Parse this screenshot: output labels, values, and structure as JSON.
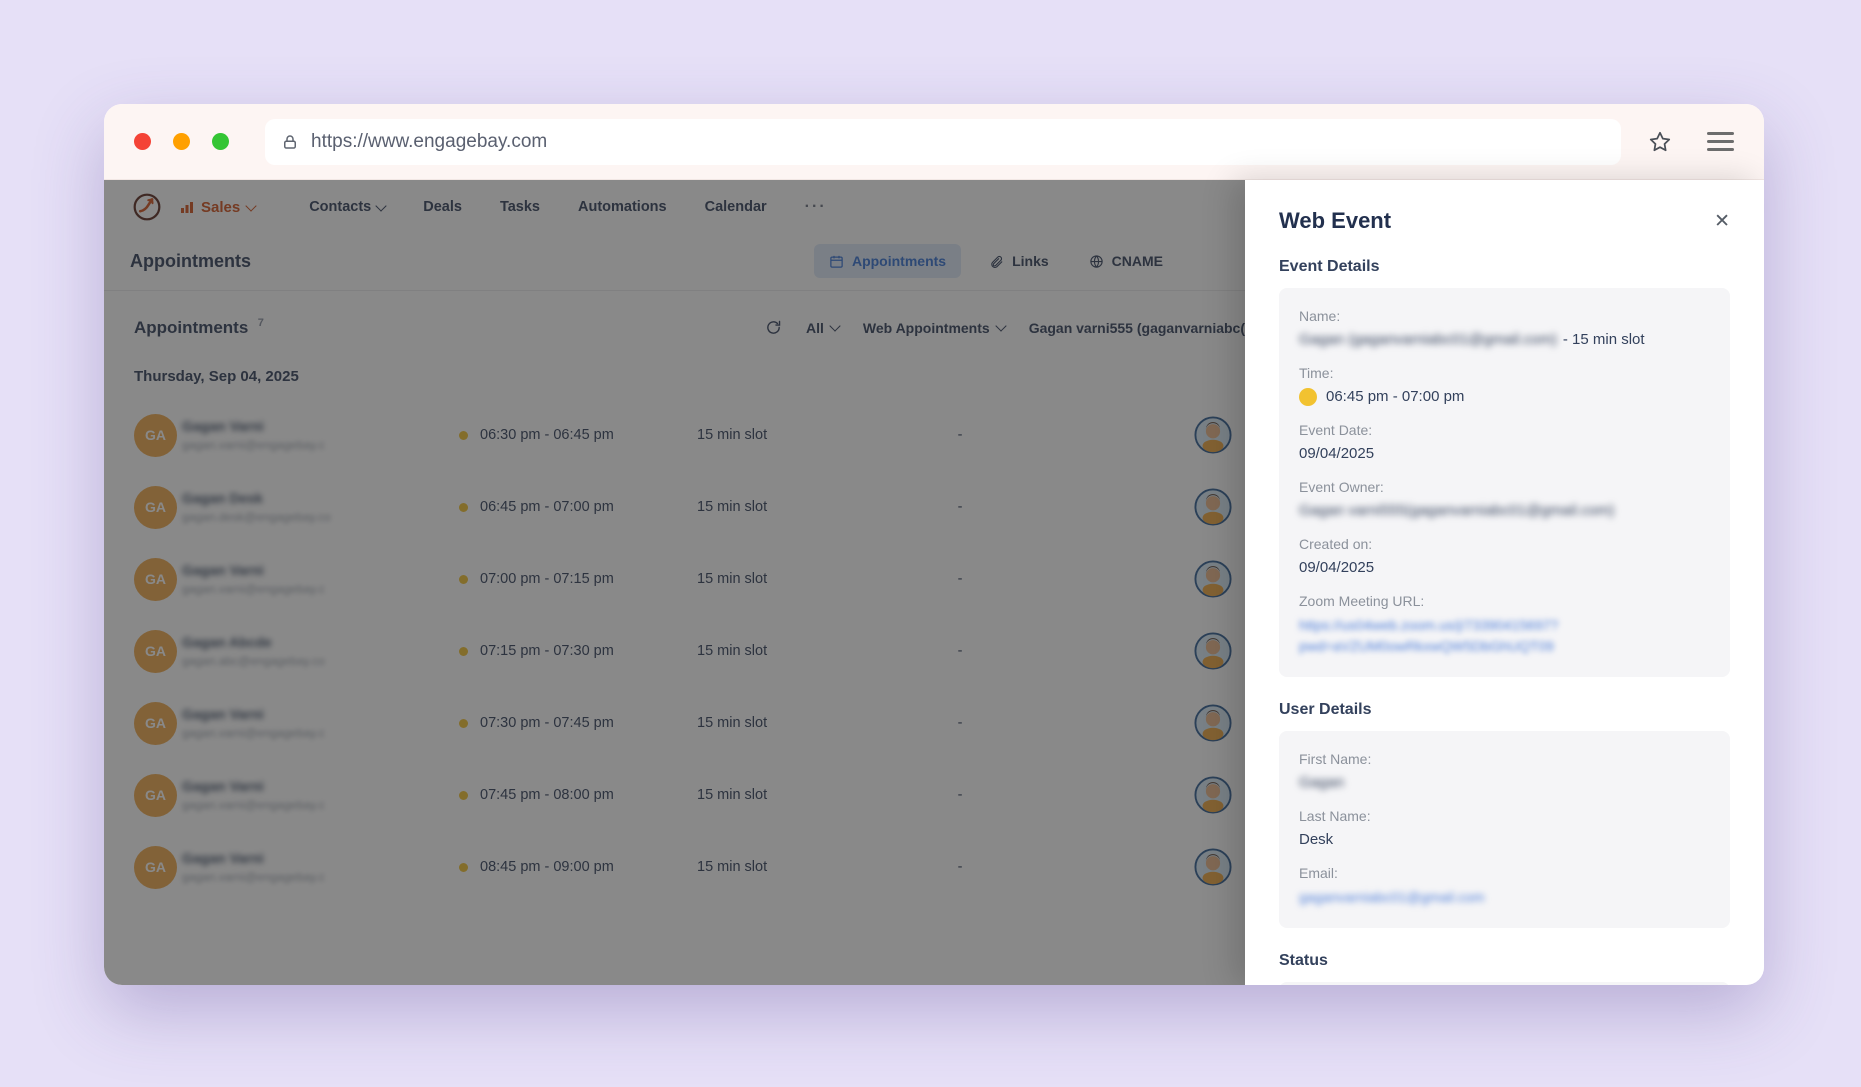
{
  "colors": {
    "brand_orange": "#d2521e",
    "navy_text": "#33415c",
    "active_tab_blue": "#3572d3",
    "slot_yellow": "#f2c230",
    "avatar_orange": "#efa94d",
    "background_lavender": "#e6e0f7"
  },
  "browser": {
    "url": "https://www.engagebay.com"
  },
  "app_nav": {
    "sales_label": "Sales",
    "items": [
      {
        "label": "Contacts"
      },
      {
        "label": "Deals"
      },
      {
        "label": "Tasks"
      },
      {
        "label": "Automations"
      },
      {
        "label": "Calendar"
      }
    ],
    "more_glyph": "···"
  },
  "page_header": {
    "title": "Appointments",
    "tabs": [
      {
        "label": "Appointments"
      },
      {
        "label": "Links"
      },
      {
        "label": "CNAME"
      }
    ]
  },
  "toolbar": {
    "heading": "Appointments",
    "count": "7",
    "filter_all": "All",
    "filter_type": "Web Appointments",
    "filter_owner": "Gagan varni555 (gaganvarniabc("
  },
  "list": {
    "date_header": "Thursday, Sep 04, 2025",
    "rows": [
      {
        "initials": "GA",
        "name_blurred": "Gagan Varni",
        "email_blurred": "gagan.varni@engagebay.c",
        "time": "06:30 pm - 06:45 pm",
        "slot": "15 min slot",
        "empty": "-"
      },
      {
        "initials": "GA",
        "name_blurred": "Gagan Desk",
        "email_blurred": "gagan.desk@engagebay.co",
        "time": "06:45 pm - 07:00 pm",
        "slot": "15 min slot",
        "empty": "-"
      },
      {
        "initials": "GA",
        "name_blurred": "Gagan Varni",
        "email_blurred": "gagan.varni@engagebay.c",
        "time": "07:00 pm - 07:15 pm",
        "slot": "15 min slot",
        "empty": "-"
      },
      {
        "initials": "GA",
        "name_blurred": "Gagan Abcde",
        "email_blurred": "gagan.abc@engagebay.co",
        "time": "07:15 pm - 07:30 pm",
        "slot": "15 min slot",
        "empty": "-"
      },
      {
        "initials": "GA",
        "name_blurred": "Gagan Varni",
        "email_blurred": "gagan.varni@engagebay.c",
        "time": "07:30 pm - 07:45 pm",
        "slot": "15 min slot",
        "empty": "-"
      },
      {
        "initials": "GA",
        "name_blurred": "Gagan Varni",
        "email_blurred": "gagan.varni@engagebay.c",
        "time": "07:45 pm - 08:00 pm",
        "slot": "15 min slot",
        "empty": "-"
      },
      {
        "initials": "GA",
        "name_blurred": "Gagan Varni",
        "email_blurred": "gagan.varni@engagebay.c",
        "time": "08:45 pm - 09:00 pm",
        "slot": "15 min slot",
        "empty": "-"
      }
    ]
  },
  "panel": {
    "title": "Web Event",
    "close_glyph": "✕",
    "event_details": {
      "heading": "Event Details",
      "name_label": "Name:",
      "name_blurred": "Gagan (gaganvarniabc01@gmail.com)",
      "name_suffix": "- 15 min slot",
      "time_label": "Time:",
      "time_value": "06:45 pm - 07:00 pm",
      "event_date_label": "Event Date:",
      "event_date_value": "09/04/2025",
      "owner_label": "Event Owner:",
      "owner_blurred": "Gagan varni555(gaganvarniabc01@gmail.com)",
      "created_label": "Created on:",
      "created_value": "09/04/2025",
      "zoom_label": "Zoom Meeting URL:",
      "zoom_line1_blurred": "https://us04web.zoom.us/j/73390415697?",
      "zoom_line2_blurred": "pwd=aVZUM0owRkxwQW5DbGhUQT09"
    },
    "user_details": {
      "heading": "User Details",
      "first_name_label": "First Name:",
      "first_name_blurred": "Gagan",
      "last_name_label": "Last Name:",
      "last_name_value": "Desk",
      "email_label": "Email:",
      "email_blurred": "gaganvarniabc01@gmail.com"
    },
    "status": {
      "heading": "Status"
    }
  }
}
